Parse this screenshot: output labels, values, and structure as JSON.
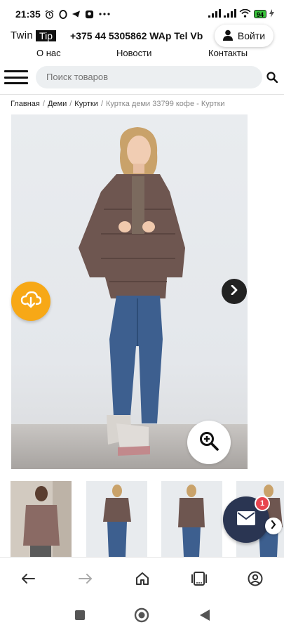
{
  "status_bar": {
    "time": "21:35",
    "battery": "94"
  },
  "header": {
    "logo_twin": "Twin",
    "logo_tip": "Tip",
    "phone": "+375 44 5305862 WAp Tel Vb",
    "login_label": "Войти"
  },
  "nav": {
    "items": [
      "О нас",
      "Новости",
      "Контакты"
    ]
  },
  "search": {
    "placeholder": "Поиск товаров"
  },
  "breadcrumb": {
    "items": [
      "Главная",
      "Деми",
      "Куртки"
    ],
    "current": "Куртка деми 33799 кофе - Куртки"
  },
  "mail": {
    "badge_count": "1"
  },
  "colors": {
    "fab_orange": "#f7a816",
    "mail_navy": "#2a3552",
    "badge_red": "#e8454f",
    "jacket": "#6e5650",
    "jeans": "#3d5f8f"
  },
  "icons": [
    "alarm-icon",
    "opera-icon",
    "telegram-icon",
    "app-icon",
    "more-icon",
    "signal-icon",
    "wifi-icon",
    "battery-icon",
    "charging-icon",
    "user-icon",
    "menu-icon",
    "search-icon",
    "chevron-right-icon",
    "cloud-download-icon",
    "zoom-in-icon",
    "mail-icon",
    "back-icon",
    "forward-icon",
    "home-icon",
    "tabs-icon",
    "profile-icon",
    "square-icon",
    "circle-icon",
    "triangle-back-icon"
  ]
}
